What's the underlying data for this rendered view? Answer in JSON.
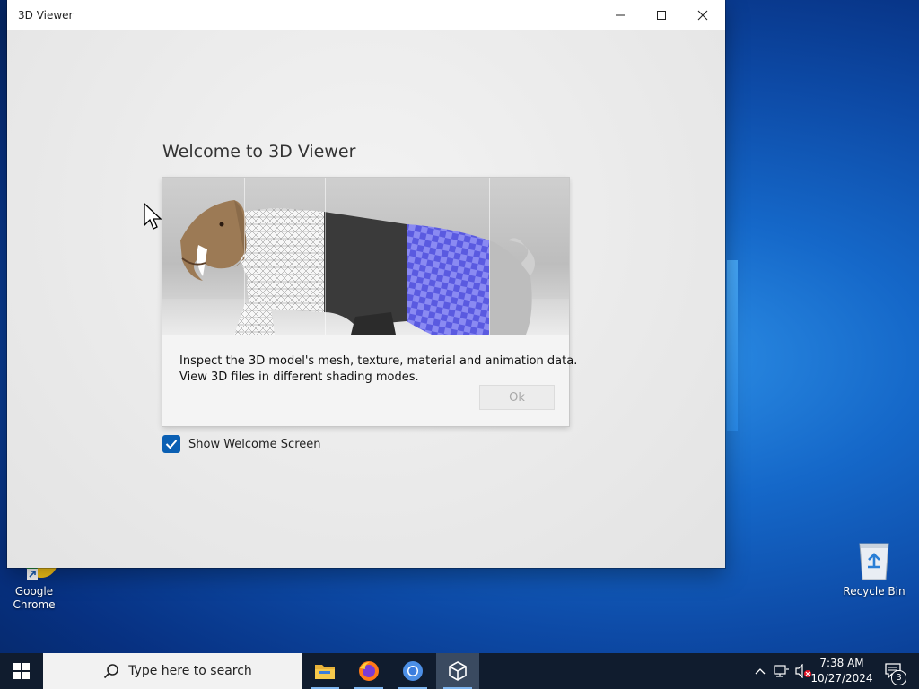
{
  "desktop": {
    "icons": [
      {
        "label_line1": "Google",
        "label_line2": "Chrome"
      },
      {
        "label_line1": "Recycle Bin",
        "label_line2": ""
      }
    ]
  },
  "window": {
    "title": "3D Viewer",
    "controls": {
      "minimize": "minimize-icon",
      "maximize": "maximize-icon",
      "close": "close-icon"
    }
  },
  "welcome": {
    "heading": "Welcome to 3D Viewer",
    "description_line1": "Inspect the 3D model's mesh, texture, material and animation data.",
    "description_line2": "View 3D files in different shading modes.",
    "ok_label": "Ok",
    "checkbox_label": "Show Welcome Screen",
    "checkbox_checked": true
  },
  "taskbar": {
    "search_placeholder": "Type here to search",
    "apps": [
      "file-explorer-icon",
      "firefox-icon",
      "chrome-icon",
      "3d-viewer-icon"
    ],
    "clock_time": "7:38 AM",
    "clock_date": "10/27/2024",
    "notification_count": "3"
  },
  "colors": {
    "accent": "#0a5fb3",
    "taskbar": "#101c2e",
    "checker_blue": "#6b6bea"
  }
}
